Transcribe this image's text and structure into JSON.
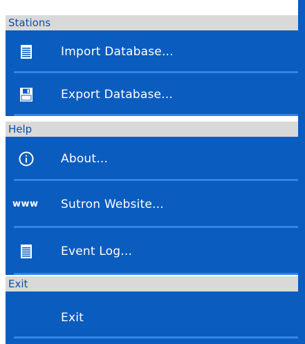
{
  "colors": {
    "menu_blue": "#0b5cbf",
    "separator_blue": "#2f86e6",
    "header_gray": "#d9d9d9",
    "header_text_blue": "#0b4fa3",
    "text_white": "#ffffff"
  },
  "sections": {
    "stations": {
      "title": "Stations",
      "items": [
        {
          "label": "Import Database...",
          "icon": "document-icon"
        },
        {
          "label": "Export Database...",
          "icon": "floppy-disk-icon"
        }
      ]
    },
    "help": {
      "title": "Help",
      "items": [
        {
          "label": "About...",
          "icon": "info-icon"
        },
        {
          "label": "Sutron Website...",
          "icon": "www-icon",
          "icon_text": "www"
        },
        {
          "label": "Event Log...",
          "icon": "document-icon"
        }
      ]
    },
    "exit": {
      "title": "Exit",
      "items": [
        {
          "label": "Exit"
        }
      ]
    }
  }
}
